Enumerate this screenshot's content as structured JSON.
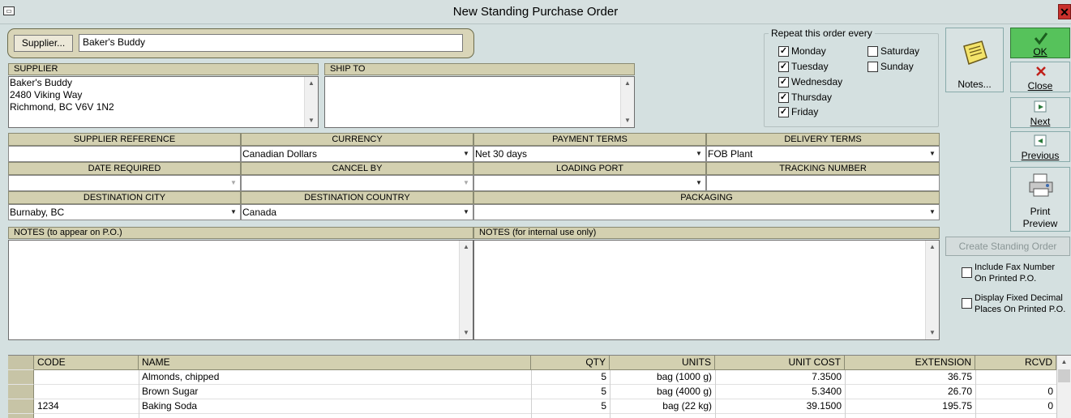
{
  "window": {
    "title": "New Standing Purchase Order",
    "close_label": "✕"
  },
  "supplier": {
    "button_label": "Supplier...",
    "value": "Baker's Buddy"
  },
  "supplier_section": {
    "header": "SUPPLIER",
    "address_lines": [
      "Baker's Buddy",
      "2480 Viking Way",
      "Richmond, BC  V6V 1N2"
    ]
  },
  "ship_to": {
    "header": "SHIP TO",
    "address_lines": []
  },
  "fields": {
    "supplier_reference": {
      "label": "SUPPLIER REFERENCE",
      "value": ""
    },
    "currency": {
      "label": "CURRENCY",
      "value": "Canadian Dollars"
    },
    "payment_terms": {
      "label": "PAYMENT TERMS",
      "value": "Net 30 days"
    },
    "delivery_terms": {
      "label": "DELIVERY TERMS",
      "value": "FOB Plant"
    },
    "date_required": {
      "label": "DATE REQUIRED",
      "value": ""
    },
    "cancel_by": {
      "label": "CANCEL BY",
      "value": ""
    },
    "loading_port": {
      "label": "LOADING PORT",
      "value": ""
    },
    "tracking_number": {
      "label": "TRACKING NUMBER",
      "value": ""
    },
    "destination_city": {
      "label": "DESTINATION CITY",
      "value": "Burnaby, BC"
    },
    "destination_country": {
      "label": "DESTINATION COUNTRY",
      "value": "Canada"
    },
    "packaging": {
      "label": "PACKAGING",
      "value": ""
    }
  },
  "repeat": {
    "legend": "Repeat this order every",
    "days": [
      {
        "label": "Monday",
        "checked": true
      },
      {
        "label": "Tuesday",
        "checked": true
      },
      {
        "label": "Wednesday",
        "checked": true
      },
      {
        "label": "Thursday",
        "checked": true
      },
      {
        "label": "Friday",
        "checked": true
      },
      {
        "label": "Saturday",
        "checked": false
      },
      {
        "label": "Sunday",
        "checked": false
      }
    ]
  },
  "buttons": {
    "notes": "Notes...",
    "ok": "OK",
    "close": "Close",
    "next": "Next",
    "previous": "Previous",
    "print_preview_line1": "Print",
    "print_preview_line2": "Preview",
    "create_standing_order": "Create Standing Order"
  },
  "options": {
    "include_fax_line1": "Include Fax Number",
    "include_fax_line2": "On Printed P.O.",
    "include_fax_checked": false,
    "fixed_decimal_line1": "Display Fixed Decimal",
    "fixed_decimal_line2": "Places On Printed P.O.",
    "fixed_decimal_checked": false
  },
  "notes": {
    "external_label": "NOTES (to appear on P.O.)",
    "internal_label": "NOTES (for internal use only)"
  },
  "grid": {
    "columns": [
      "CODE",
      "NAME",
      "QTY",
      "UNITS",
      "UNIT COST",
      "EXTENSION",
      "RCVD"
    ],
    "rows": [
      [
        "",
        "Almonds, chipped",
        "5",
        "bag (1000 g)",
        "7.3500",
        "36.75",
        ""
      ],
      [
        "",
        "Brown Sugar",
        "5",
        "bag (4000 g)",
        "5.3400",
        "26.70",
        "0"
      ],
      [
        "1234",
        "Baking Soda",
        "5",
        "bag (22 kg)",
        "39.1500",
        "195.75",
        "0"
      ]
    ]
  },
  "colors": {
    "ok_green": "#56c25b",
    "close_red": "#c8302c",
    "background": "#d4e0e0",
    "header_tan": "#d3d0b0"
  }
}
